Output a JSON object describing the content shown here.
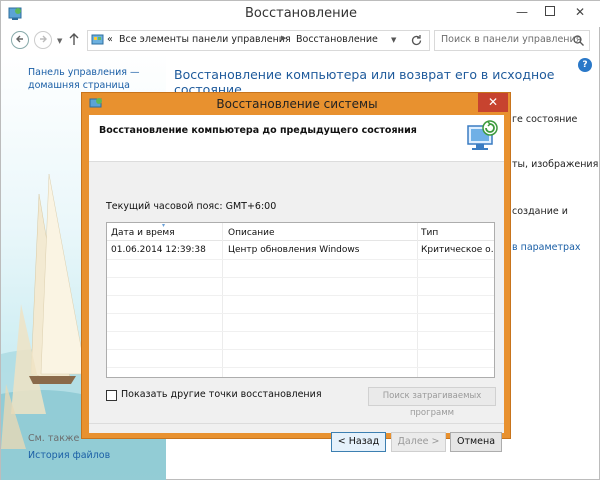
{
  "window": {
    "title": "Восстановление",
    "minimize": "—",
    "close": "✕"
  },
  "address": {
    "chevron": "«",
    "crumb1": "Все элементы панели управления",
    "crumb2": "Восстановление",
    "search_placeholder": "Поиск в панели управления"
  },
  "leftpane": {
    "home_line1": "Панель управления —",
    "home_line2": "домашняя страница",
    "see_also": "См. также",
    "file_history": "История файлов"
  },
  "main": {
    "heading": "Восстановление компьютера или возврат его в исходное состояние",
    "frag1": "ге состояние",
    "frag2": "ты, изображения",
    "frag3": "создание и",
    "frag4": "в параметрах"
  },
  "dialog": {
    "title": "Восстановление системы",
    "close": "✕",
    "header": "Восстановление компьютера до предыдущего состояния",
    "timezone": "Текущий часовой пояс: GMT+6:00",
    "columns": [
      "Дата и время",
      "Описание",
      "Тип"
    ],
    "rows": [
      {
        "date": "01.06.2014 12:39:38",
        "description": "Центр обновления Windows",
        "type": "Критическое о..."
      }
    ],
    "show_more": "Показать другие точки восстановления",
    "scan_button": "Поиск затрагиваемых программ",
    "back_button": "< Назад",
    "next_button": "Далее >",
    "cancel_button": "Отмена"
  },
  "colors": {
    "dialog_frame": "#e8912f",
    "close_button": "#c7432f",
    "link": "#1b5fa6",
    "heading": "#1e5a9b"
  },
  "icons": [
    "app-icon",
    "back-arrow-icon",
    "forward-arrow-icon",
    "up-arrow-icon",
    "control-panel-icon",
    "refresh-icon",
    "search-icon",
    "system-restore-icon",
    "sort-arrow-icon"
  ]
}
